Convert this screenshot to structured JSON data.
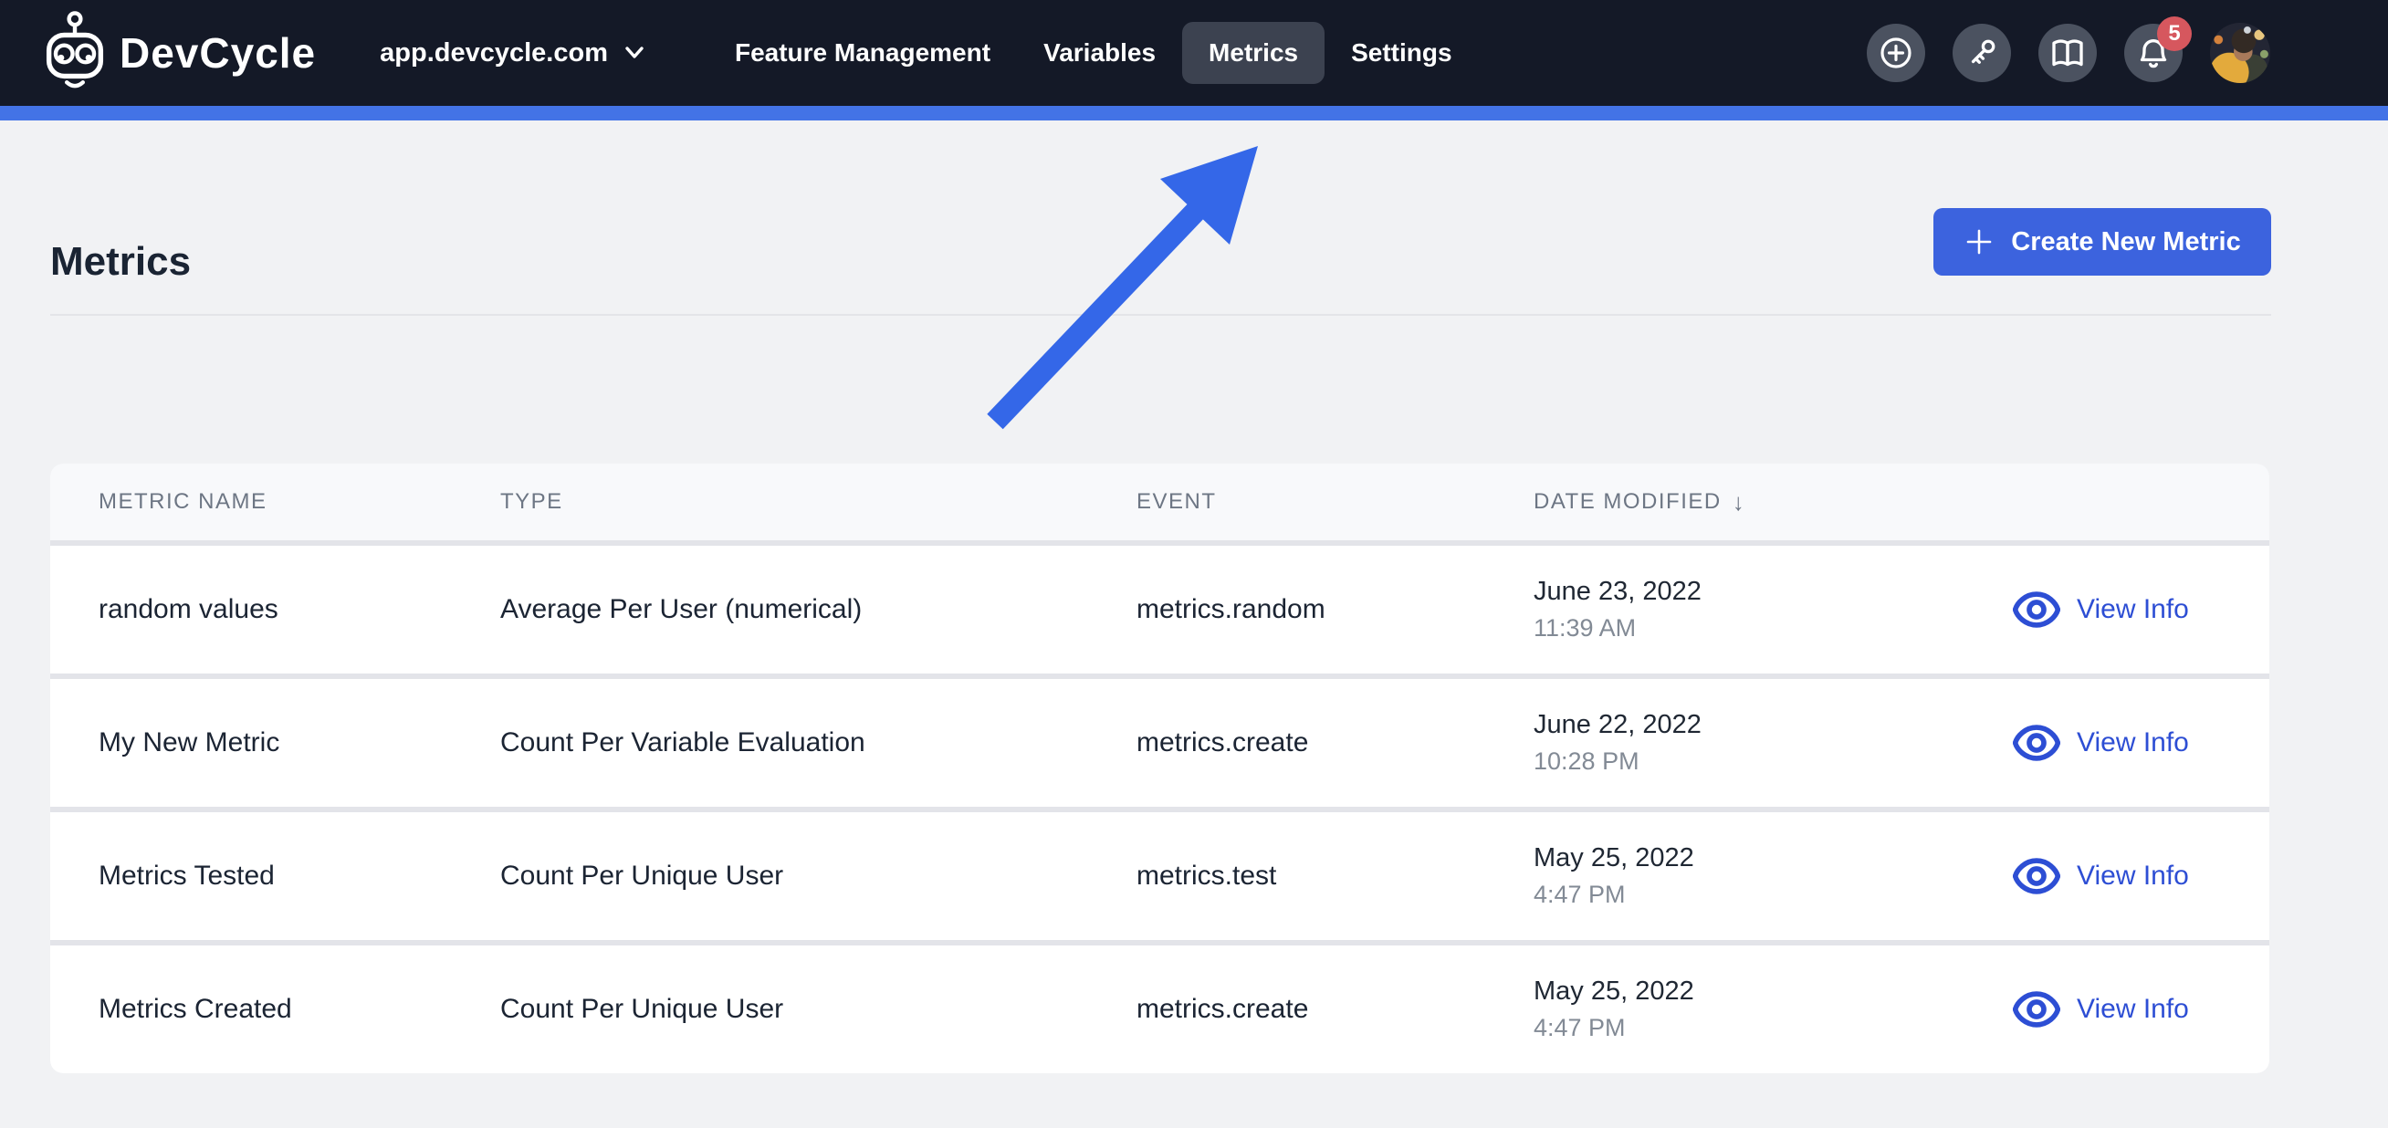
{
  "nav": {
    "brand": "DevCycle",
    "org": "app.devcycle.com",
    "items": [
      {
        "label": "Feature Management",
        "active": false
      },
      {
        "label": "Variables",
        "active": false
      },
      {
        "label": "Metrics",
        "active": true
      },
      {
        "label": "Settings",
        "active": false
      }
    ],
    "notification_count": "5",
    "icons": [
      "plus-circle-icon",
      "key-icon",
      "book-icon",
      "bell-icon"
    ]
  },
  "page": {
    "title": "Metrics",
    "create_button_label": "Create New Metric"
  },
  "table": {
    "columns": [
      "METRIC NAME",
      "TYPE",
      "EVENT",
      "DATE MODIFIED"
    ],
    "sort_column": "DATE MODIFIED",
    "sort_indicator": "↓",
    "action_label": "View Info",
    "rows": [
      {
        "name": "random values",
        "type": "Average Per User (numerical)",
        "event": "metrics.random",
        "date": "June 23, 2022",
        "time": "11:39 AM"
      },
      {
        "name": "My New Metric",
        "type": "Count Per Variable Evaluation",
        "event": "metrics.create",
        "date": "June 22, 2022",
        "time": "10:28 PM"
      },
      {
        "name": "Metrics Tested",
        "type": "Count Per Unique User",
        "event": "metrics.test",
        "date": "May 25, 2022",
        "time": "4:47 PM"
      },
      {
        "name": "Metrics Created",
        "type": "Count Per Unique User",
        "event": "metrics.create",
        "date": "May 25, 2022",
        "time": "4:47 PM"
      }
    ]
  },
  "colors": {
    "nav_background": "#141927",
    "accent_bar": "#4373e6",
    "primary_button": "#3c63de",
    "link_blue": "#2d4ed4",
    "arrow_annotation": "#3467e8",
    "badge_red": "#d6575e",
    "page_background": "#f1f2f4"
  }
}
